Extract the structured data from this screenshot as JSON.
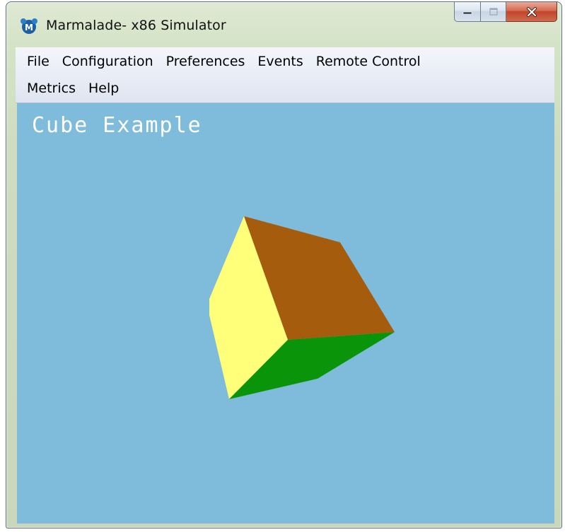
{
  "window": {
    "title": "Marmalade- x86 Simulator",
    "app_icon_letter": "M"
  },
  "menus": {
    "row1": [
      "File",
      "Configuration",
      "Preferences",
      "Events",
      "Remote Control"
    ],
    "row2": [
      "Metrics",
      "Help"
    ]
  },
  "viewport": {
    "title": "Cube Example",
    "background": "#7fbcdb"
  },
  "cube": {
    "face_colors": {
      "top": "#a65c0d",
      "left": "#ffff7a",
      "bottom": "#0a940a"
    }
  },
  "caption_buttons": {
    "minimize_icon": "minimize-icon",
    "maximize_icon": "maximize-icon",
    "close_icon": "close-icon"
  }
}
